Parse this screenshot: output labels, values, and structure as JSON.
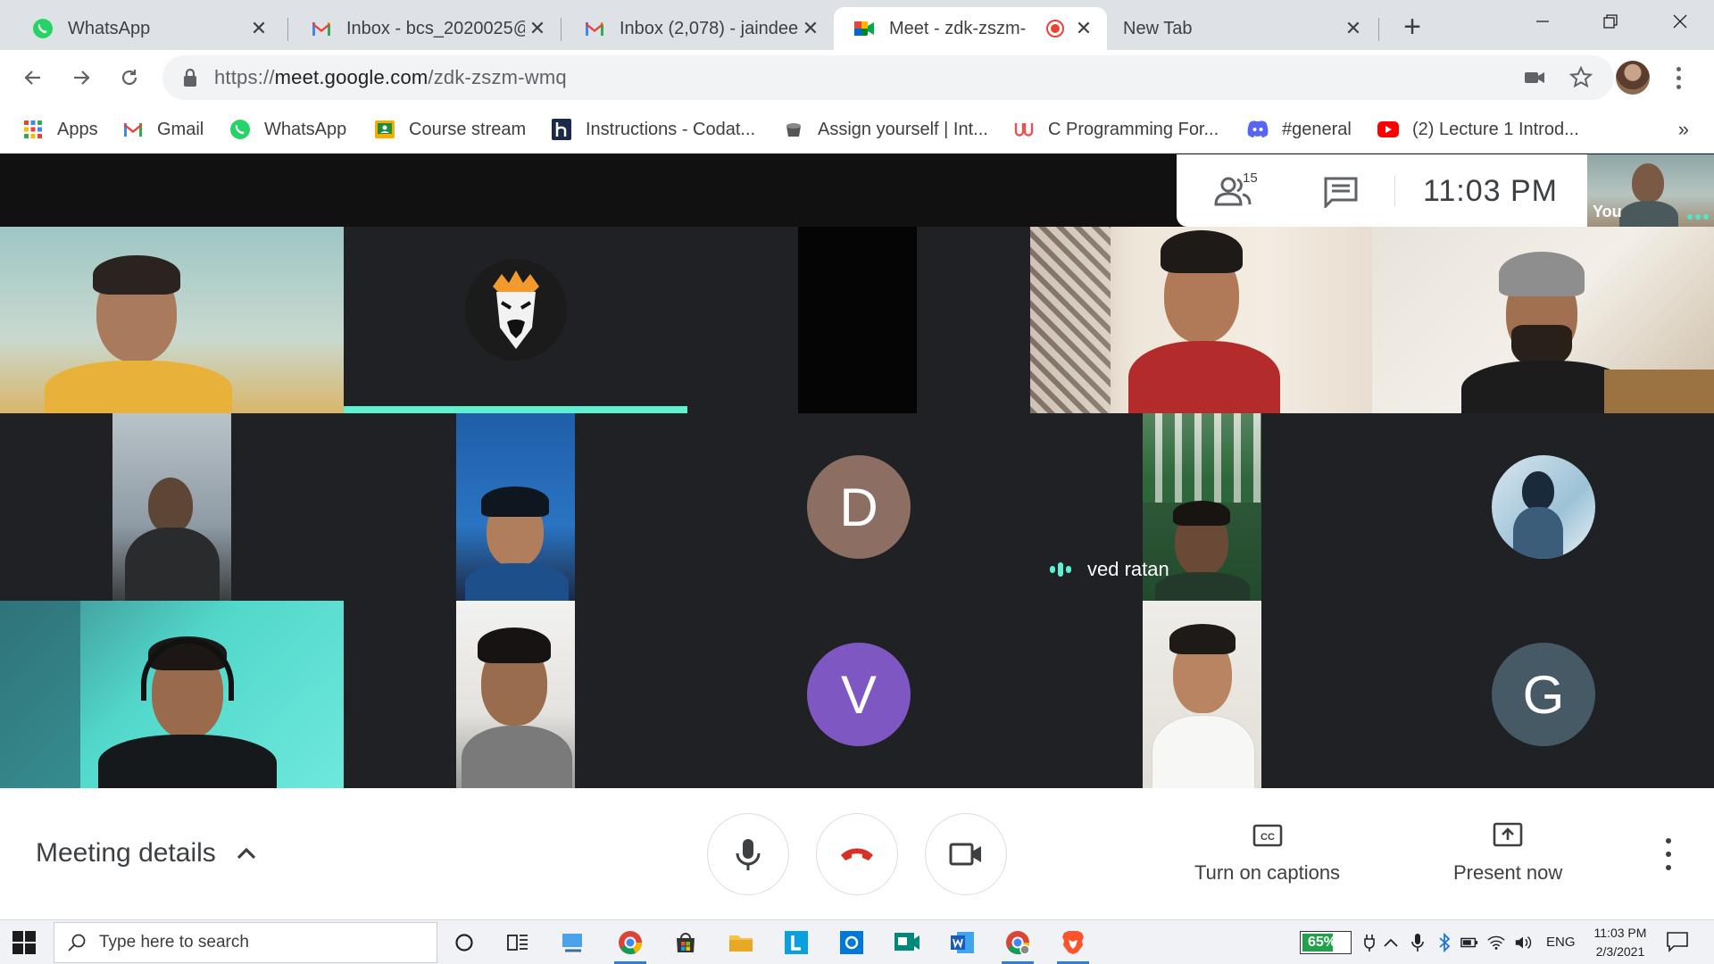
{
  "browser": {
    "tabs": [
      {
        "title": "WhatsApp",
        "icon": "whatsapp-icon",
        "active": false
      },
      {
        "title": "Inbox - bcs_2020025@",
        "icon": "gmail-icon",
        "active": false
      },
      {
        "title": "Inbox (2,078) - jaindee",
        "icon": "gmail-icon",
        "active": false
      },
      {
        "title": "Meet - zdk-zszm-",
        "icon": "google-meet-icon",
        "active": true,
        "recording": true
      },
      {
        "title": "New Tab",
        "icon": "",
        "active": false
      }
    ],
    "url": {
      "prefix": "https://",
      "host": "meet.google.com",
      "path": "/zdk-zszm-wmq"
    },
    "bookmarks": [
      {
        "label": "Apps",
        "icon": "apps-grid-icon"
      },
      {
        "label": "Gmail",
        "icon": "gmail-icon"
      },
      {
        "label": "WhatsApp",
        "icon": "whatsapp-icon"
      },
      {
        "label": "Course stream",
        "icon": "google-classroom-icon"
      },
      {
        "label": "Instructions - Codat...",
        "icon": "hackerrank-icon"
      },
      {
        "label": "Assign yourself | Int...",
        "icon": "bookmark-page-icon"
      },
      {
        "label": "C Programming For...",
        "icon": "udemy-icon"
      },
      {
        "label": "#general",
        "icon": "discord-icon"
      },
      {
        "label": "(2) Lecture 1 Introd...",
        "icon": "youtube-icon"
      }
    ],
    "bookmarks_overflow": "»"
  },
  "meet": {
    "participants_count": "15",
    "clock": "11:03 PM",
    "self_label": "You",
    "tiles": [
      {
        "name": "",
        "type": "video",
        "avatar": ""
      },
      {
        "name": "",
        "type": "avatar-image",
        "avatar": "",
        "speaking": true
      },
      {
        "name": "",
        "type": "video-dark",
        "avatar": ""
      },
      {
        "name": "",
        "type": "video",
        "avatar": ""
      },
      {
        "name": "",
        "type": "video",
        "avatar": ""
      },
      {
        "name": "",
        "type": "video",
        "avatar": ""
      },
      {
        "name": "",
        "type": "video",
        "avatar": ""
      },
      {
        "name": "",
        "type": "letter",
        "avatar": "D"
      },
      {
        "name": "ved ratan",
        "type": "video",
        "avatar": "",
        "speaking": true
      },
      {
        "name": "",
        "type": "avatar-image",
        "avatar": ""
      },
      {
        "name": "",
        "type": "video",
        "avatar": ""
      },
      {
        "name": "",
        "type": "video",
        "avatar": ""
      },
      {
        "name": "",
        "type": "letter",
        "avatar": "V"
      },
      {
        "name": "",
        "type": "video",
        "avatar": ""
      },
      {
        "name": "",
        "type": "letter",
        "avatar": "G"
      }
    ],
    "controls": {
      "meeting_details": "Meeting details",
      "captions": "Turn on captions",
      "present": "Present now"
    },
    "colors": {
      "accent": "#5ef0d0",
      "hangup": "#d93025",
      "avatar_d": "#8d6e63",
      "avatar_v": "#7e57c2",
      "avatar_g": "#455a64"
    }
  },
  "taskbar": {
    "search_placeholder": "Type here to search",
    "battery": "65%",
    "language": "ENG",
    "time": "11:03 PM",
    "date": "2/3/2021"
  }
}
